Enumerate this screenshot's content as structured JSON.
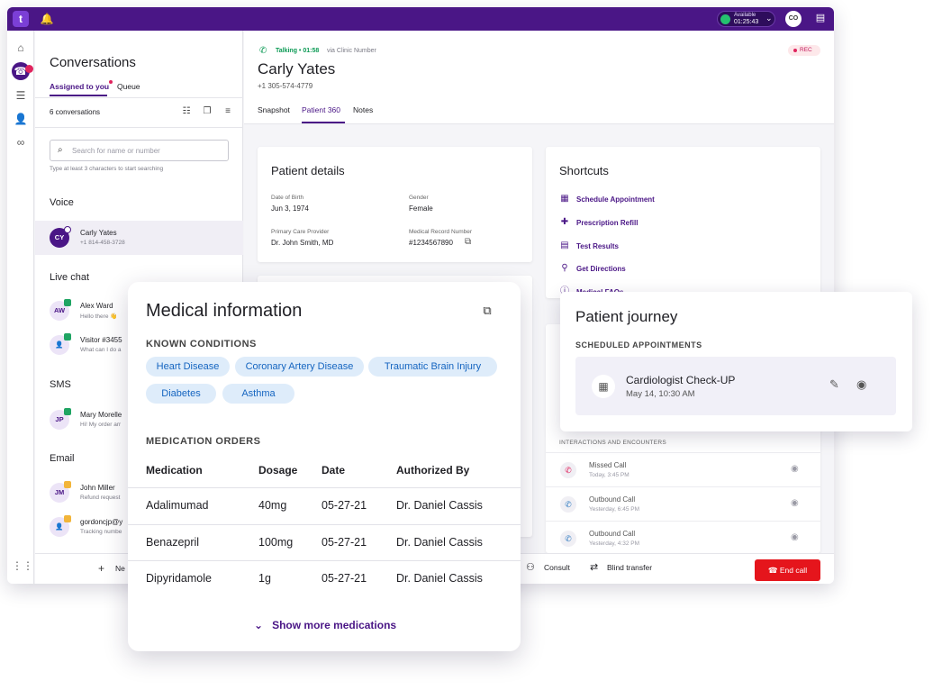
{
  "app": {
    "status_label": "Available",
    "status_timer": "01:25:43",
    "user_initials": "CO"
  },
  "conversations": {
    "title": "Conversations",
    "tabs": [
      {
        "label": "Assigned to you"
      },
      {
        "label": "Queue"
      }
    ],
    "count_label": "6 conversations",
    "search": {
      "placeholder": "Search for name or number",
      "hint": "Type at least 3 characters to start searching"
    },
    "sections": {
      "voice": "Voice",
      "live_chat": "Live chat",
      "sms": "SMS",
      "email": "Email"
    },
    "items": [
      {
        "initials": "CY",
        "name": "Carly Yates",
        "sub": "+1 814-458-3728"
      },
      {
        "initials": "AW",
        "name": "Alex Ward",
        "sub": "Hello there 👋"
      },
      {
        "initials": "",
        "name": "Visitor #3455",
        "sub": "What can I do a"
      },
      {
        "initials": "JP",
        "name": "Mary Morelle",
        "sub": "Hi! My order arr"
      },
      {
        "initials": "JM",
        "name": "John Miller",
        "sub": "Refund request"
      },
      {
        "initials": "",
        "name": "gordoncjp@y",
        "sub": "Tracking numbe"
      }
    ],
    "new_label": "Ne"
  },
  "call": {
    "status": "Talking • 01:58",
    "via": "via Clinic Number",
    "patient_name": "Carly Yates",
    "patient_phone": "+1 305-574-4779",
    "rec_label": "REC",
    "tabs": [
      {
        "label": "Snapshot"
      },
      {
        "label": "Patient 360"
      },
      {
        "label": "Notes"
      }
    ],
    "consult_label": "Consult",
    "blind_transfer_label": "Blind transfer",
    "end_call_label": "End call"
  },
  "patient_details": {
    "title": "Patient details",
    "fields": [
      {
        "label": "Date of Birth",
        "value": "Jun 3, 1974"
      },
      {
        "label": "Gender",
        "value": "Female"
      },
      {
        "label": "Primary Care Provider",
        "value": "Dr. John Smith, MD"
      },
      {
        "label": "Medical Record Number",
        "value": "#1234567890"
      }
    ]
  },
  "shortcuts": {
    "title": "Shortcuts",
    "items": [
      {
        "label": "Schedule Appointment",
        "icon": "calendar-icon"
      },
      {
        "label": "Prescription Refill",
        "icon": "pill-bottle-icon"
      },
      {
        "label": "Test Results",
        "icon": "clipboard-icon"
      },
      {
        "label": "Get Directions",
        "icon": "location-pin-icon"
      },
      {
        "label": "Medical FAQs",
        "icon": "info-icon"
      }
    ]
  },
  "interactions": {
    "title": "INTERACTIONS AND ENCOUNTERS",
    "items": [
      {
        "name": "Missed Call",
        "time": "Today, 3:45 PM"
      },
      {
        "name": "Outbound Call",
        "time": "Yesterday, 6:45 PM"
      },
      {
        "name": "Outbound Call",
        "time": "Yesterday, 4:32 PM"
      }
    ]
  },
  "medical": {
    "title": "Medical information",
    "conditions_heading": "KNOWN CONDITIONS",
    "conditions": [
      "Heart Disease",
      "Coronary Artery Disease",
      "Traumatic Brain Injury",
      "Diabetes",
      "Asthma"
    ],
    "orders_heading": "MEDICATION ORDERS",
    "columns": [
      "Medication",
      "Dosage",
      "Date",
      "Authorized By"
    ],
    "rows": [
      [
        "Adalimumad",
        "40mg",
        "05-27-21",
        "Dr. Daniel Cassis"
      ],
      [
        "Benazepril",
        "100mg",
        "05-27-21",
        "Dr. Daniel Cassis"
      ],
      [
        "Dipyridamole",
        "1g",
        "05-27-21",
        "Dr. Daniel Cassis"
      ]
    ],
    "show_more": "Show more medications"
  },
  "journey": {
    "title": "Patient journey",
    "heading": "SCHEDULED APPOINTMENTS",
    "appointment": {
      "name": "Cardiologist Check-UP",
      "date": "May 14, 10:30 AM"
    }
  },
  "colors": {
    "brand": "#4a1686",
    "available": "#25c16f",
    "end_call": "#e5151c",
    "chip_bg": "#deecfa",
    "chip_text": "#1565c0"
  }
}
